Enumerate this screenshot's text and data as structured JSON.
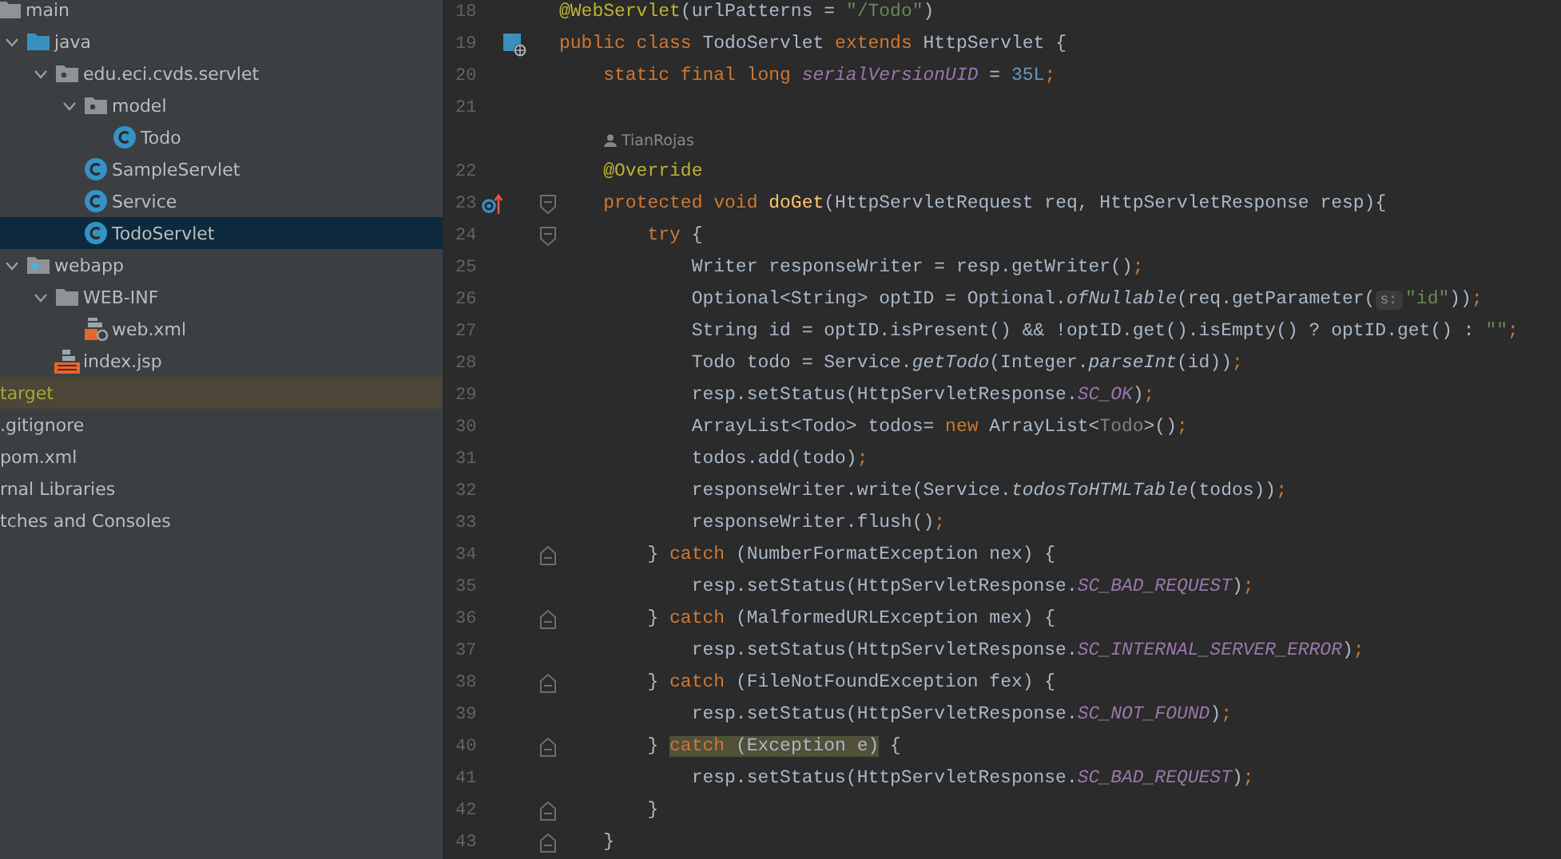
{
  "project_tree": [
    {
      "label": "main",
      "kind": "folder",
      "selected": false,
      "children": [
        {
          "label": "java",
          "kind": "source_folder",
          "expanded": true,
          "selected": false,
          "children": [
            {
              "label": "edu.eci.cvds.servlet",
              "kind": "package",
              "expanded": true,
              "selected": false,
              "children": [
                {
                  "label": "model",
                  "kind": "package",
                  "expanded": true,
                  "selected": false,
                  "children": [
                    {
                      "label": "Todo",
                      "kind": "class",
                      "selected": false
                    }
                  ]
                },
                {
                  "label": "SampleServlet",
                  "kind": "class",
                  "selected": false
                },
                {
                  "label": "Service",
                  "kind": "class",
                  "selected": false
                },
                {
                  "label": "TodoServlet",
                  "kind": "class",
                  "selected": true
                }
              ]
            }
          ]
        },
        {
          "label": "webapp",
          "kind": "web_folder",
          "expanded": true,
          "selected": false,
          "children": [
            {
              "label": "WEB-INF",
              "kind": "folder",
              "expanded": true,
              "selected": false,
              "children": [
                {
                  "label": "web.xml",
                  "kind": "xml",
                  "selected": false
                }
              ]
            },
            {
              "label": "index.jsp",
              "kind": "jsp",
              "selected": false
            }
          ]
        }
      ]
    }
  ],
  "root_items": [
    {
      "label": "target",
      "kind": "excluded",
      "selected": false
    },
    {
      "label": ".gitignore",
      "kind": "plain",
      "selected": false
    },
    {
      "label": "pom.xml",
      "kind": "plain",
      "selected": false
    },
    {
      "label": "rnal Libraries",
      "kind": "plain",
      "selected": false
    },
    {
      "label": "tches and Consoles",
      "kind": "plain",
      "selected": false
    }
  ],
  "editor_lines": [
    {
      "kind": "code",
      "number": "18",
      "tokens": [
        {
          "kind": "ann",
          "text": "@WebServlet"
        },
        {
          "kind": "plain",
          "text": "(urlPatterns = "
        },
        {
          "kind": "str",
          "text": "\"/Todo\""
        },
        {
          "kind": "plain",
          "text": ")"
        }
      ]
    },
    {
      "kind": "code",
      "number": "19",
      "markers": [
        {
          "kind": "web"
        }
      ],
      "tokens": [
        {
          "kind": "kw",
          "text": "public class "
        },
        {
          "kind": "plain",
          "text": "TodoServlet "
        },
        {
          "kind": "kw",
          "text": "extends "
        },
        {
          "kind": "plain",
          "text": "HttpServlet {"
        }
      ]
    },
    {
      "kind": "code",
      "number": "20",
      "tokens": [
        {
          "kind": "kw",
          "text": "    static final long "
        },
        {
          "kind": "field",
          "text": "serialVersionUID"
        },
        {
          "kind": "plain",
          "text": " = "
        },
        {
          "kind": "num",
          "text": "35L"
        },
        {
          "kind": "semi",
          "text": ";"
        }
      ]
    },
    {
      "kind": "code",
      "number": "21"
    },
    {
      "kind": "author_hint",
      "text": "TianRojas"
    },
    {
      "kind": "code",
      "number": "22",
      "tokens": [
        {
          "kind": "ann",
          "text": "    @Override"
        }
      ]
    },
    {
      "kind": "code",
      "number": "23",
      "markers": [
        {
          "kind": "override"
        },
        {
          "kind": "fold_start"
        }
      ],
      "tokens": [
        {
          "kind": "kw",
          "text": "    protected void "
        },
        {
          "kind": "decl",
          "text": "doGet"
        },
        {
          "kind": "plain",
          "text": "(HttpServletRequest req, HttpServletResponse resp){"
        }
      ]
    },
    {
      "kind": "code",
      "number": "24",
      "markers": [
        {
          "kind": "fold_start"
        }
      ],
      "tokens": [
        {
          "kind": "kw",
          "text": "        try "
        },
        {
          "kind": "plain",
          "text": "{"
        }
      ]
    },
    {
      "kind": "code",
      "number": "25",
      "tokens": [
        {
          "kind": "plain",
          "text": "            Writer responseWriter = resp.getWriter()"
        },
        {
          "kind": "semi",
          "text": ";"
        }
      ]
    },
    {
      "kind": "code",
      "number": "26",
      "tokens": [
        {
          "kind": "plain",
          "text": "            Optional<String> optID = Optional."
        },
        {
          "kind": "smethod",
          "text": "ofNullable"
        },
        {
          "kind": "plain",
          "text": "(req.getParameter("
        },
        {
          "kind": "hint",
          "text": "s:"
        },
        {
          "kind": "str",
          "text": "\"id\""
        },
        {
          "kind": "plain",
          "text": "))"
        },
        {
          "kind": "semi",
          "text": ";"
        }
      ]
    },
    {
      "kind": "code",
      "number": "27",
      "tokens": [
        {
          "kind": "plain",
          "text": "            String id = optID.isPresent() && !optID.get().isEmpty() ? optID.get() : "
        },
        {
          "kind": "str",
          "text": "\"\""
        },
        {
          "kind": "semi",
          "text": ";"
        }
      ]
    },
    {
      "kind": "code",
      "number": "28",
      "tokens": [
        {
          "kind": "plain",
          "text": "            Todo todo = Service."
        },
        {
          "kind": "smethod",
          "text": "getTodo"
        },
        {
          "kind": "plain",
          "text": "(Integer."
        },
        {
          "kind": "smethod",
          "text": "parseInt"
        },
        {
          "kind": "plain",
          "text": "(id))"
        },
        {
          "kind": "semi",
          "text": ";"
        }
      ]
    },
    {
      "kind": "code",
      "number": "29",
      "tokens": [
        {
          "kind": "plain",
          "text": "            resp.setStatus(HttpServletResponse."
        },
        {
          "kind": "field",
          "text": "SC_OK"
        },
        {
          "kind": "plain",
          "text": ")"
        },
        {
          "kind": "semi",
          "text": ";"
        }
      ]
    },
    {
      "kind": "code",
      "number": "30",
      "tokens": [
        {
          "kind": "plain",
          "text": "            ArrayList<Todo> todos= "
        },
        {
          "kind": "kw",
          "text": "new "
        },
        {
          "kind": "plain",
          "text": "ArrayList<"
        },
        {
          "kind": "grey",
          "text": "Todo"
        },
        {
          "kind": "plain",
          "text": ">()"
        },
        {
          "kind": "semi",
          "text": ";"
        }
      ]
    },
    {
      "kind": "code",
      "number": "31",
      "tokens": [
        {
          "kind": "plain",
          "text": "            todos.add(todo)"
        },
        {
          "kind": "semi",
          "text": ";"
        }
      ]
    },
    {
      "kind": "code",
      "number": "32",
      "tokens": [
        {
          "kind": "plain",
          "text": "            responseWriter.write(Service."
        },
        {
          "kind": "smethod",
          "text": "todosToHTMLTable"
        },
        {
          "kind": "plain",
          "text": "(todos))"
        },
        {
          "kind": "semi",
          "text": ";"
        }
      ]
    },
    {
      "kind": "code",
      "number": "33",
      "tokens": [
        {
          "kind": "plain",
          "text": "            responseWriter.flush()"
        },
        {
          "kind": "semi",
          "text": ";"
        }
      ]
    },
    {
      "kind": "code",
      "number": "34",
      "markers": [
        {
          "kind": "fold_end"
        }
      ],
      "tokens": [
        {
          "kind": "plain",
          "text": "        } "
        },
        {
          "kind": "kw",
          "text": "catch "
        },
        {
          "kind": "plain",
          "text": "(NumberFormatException nex) {"
        }
      ]
    },
    {
      "kind": "code",
      "number": "35",
      "tokens": [
        {
          "kind": "plain",
          "text": "            resp.setStatus(HttpServletResponse."
        },
        {
          "kind": "field",
          "text": "SC_BAD_REQUEST"
        },
        {
          "kind": "plain",
          "text": ")"
        },
        {
          "kind": "semi",
          "text": ";"
        }
      ]
    },
    {
      "kind": "code",
      "number": "36",
      "markers": [
        {
          "kind": "fold_end"
        }
      ],
      "tokens": [
        {
          "kind": "plain",
          "text": "        } "
        },
        {
          "kind": "kw",
          "text": "catch "
        },
        {
          "kind": "plain",
          "text": "(MalformedURLException mex) {"
        }
      ]
    },
    {
      "kind": "code",
      "number": "37",
      "tokens": [
        {
          "kind": "plain",
          "text": "            resp.setStatus(HttpServletResponse."
        },
        {
          "kind": "field",
          "text": "SC_INTERNAL_SERVER_ERROR"
        },
        {
          "kind": "plain",
          "text": ")"
        },
        {
          "kind": "semi",
          "text": ";"
        }
      ]
    },
    {
      "kind": "code",
      "number": "38",
      "markers": [
        {
          "kind": "fold_end"
        }
      ],
      "tokens": [
        {
          "kind": "plain",
          "text": "        } "
        },
        {
          "kind": "kw",
          "text": "catch "
        },
        {
          "kind": "plain",
          "text": "(FileNotFoundException fex) {"
        }
      ]
    },
    {
      "kind": "code",
      "number": "39",
      "tokens": [
        {
          "kind": "plain",
          "text": "            resp.setStatus(HttpServletResponse."
        },
        {
          "kind": "field",
          "text": "SC_NOT_FOUND"
        },
        {
          "kind": "plain",
          "text": ")"
        },
        {
          "kind": "semi",
          "text": ";"
        }
      ]
    },
    {
      "kind": "code",
      "number": "40",
      "markers": [
        {
          "kind": "fold_end"
        }
      ],
      "tokens": [
        {
          "kind": "plain",
          "text": "        } "
        },
        {
          "kind": "highlight",
          "tokens": [
            {
              "kind": "kw",
              "text": "catch "
            },
            {
              "kind": "plain",
              "text": "(Exception e)"
            }
          ]
        },
        {
          "kind": "plain",
          "text": " {"
        }
      ]
    },
    {
      "kind": "code",
      "number": "41",
      "tokens": [
        {
          "kind": "plain",
          "text": "            resp.setStatus(HttpServletResponse."
        },
        {
          "kind": "field",
          "text": "SC_BAD_REQUEST"
        },
        {
          "kind": "plain",
          "text": ")"
        },
        {
          "kind": "semi",
          "text": ";"
        }
      ]
    },
    {
      "kind": "code",
      "number": "42",
      "markers": [
        {
          "kind": "fold_end"
        }
      ],
      "tokens": [
        {
          "kind": "plain",
          "text": "        }"
        }
      ]
    },
    {
      "kind": "code",
      "number": "43",
      "markers": [
        {
          "kind": "fold_end"
        }
      ],
      "tokens": [
        {
          "kind": "plain",
          "text": "    }"
        }
      ]
    }
  ]
}
